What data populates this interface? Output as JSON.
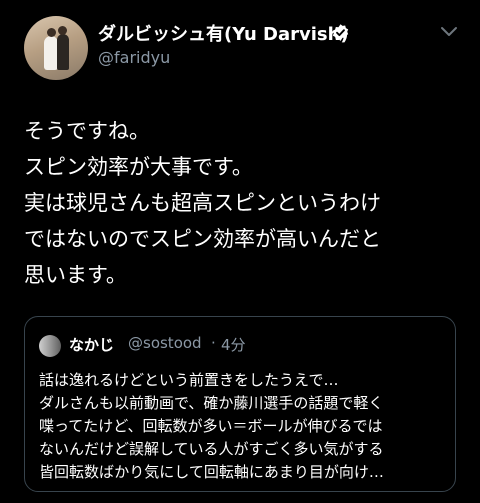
{
  "tweet": {
    "author": {
      "display_name": "ダルビッシュ有(Yu Darvish)",
      "handle": "@faridyu",
      "avatar": "wedding-photo-avatar",
      "verified_icon": "verified-badge-icon"
    },
    "menu_icon": "chevron-down-icon",
    "body_lines": [
      "そうですね。",
      "スピン効率が大事です。",
      "実は球児さんも超高スピンというわけ",
      "ではないのでスピン効率が高いんだと",
      "思います。"
    ]
  },
  "quoted_tweet": {
    "author_name": "なかじ",
    "author_handle": "@sostood",
    "separator": "·",
    "time": "4分",
    "lines": [
      "話は逸れるけどという前置きをしたうえで…",
      "ダルさんも以前動画で、確か藤川選手の話題で軽く",
      "喋ってたけど、回転数が多い＝ボールが伸びるでは",
      "ないんだけど誤解している人がすごく多い気がする",
      "皆回転数ばかり気にして回転軸にあまり目が向け…"
    ]
  },
  "colors": {
    "background": "#000000",
    "text_primary": "#ffffff",
    "text_secondary": "#8b98a5",
    "border": "#38444d"
  }
}
